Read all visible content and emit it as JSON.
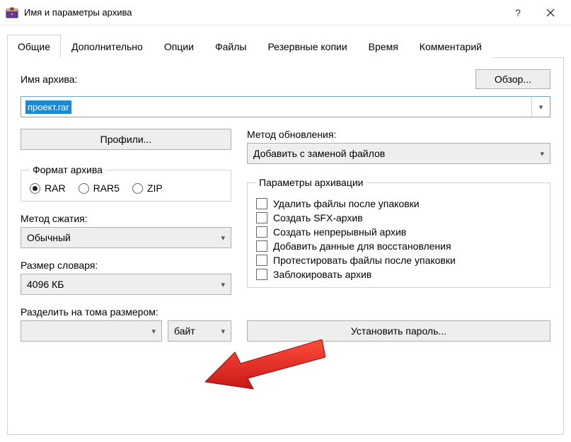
{
  "window": {
    "title": "Имя и параметры архива"
  },
  "tabs": {
    "general": "Общие",
    "advanced": "Дополнительно",
    "options": "Опции",
    "files": "Файлы",
    "backups": "Резервные копии",
    "time": "Время",
    "comment": "Комментарий"
  },
  "archive_name": {
    "label": "Имя архива:",
    "browse": "Обзор...",
    "value": "проект.rar"
  },
  "profiles_button": "Профили...",
  "update": {
    "label": "Метод обновления:",
    "value": "Добавить с заменой файлов"
  },
  "format": {
    "legend": "Формат архива",
    "rar": "RAR",
    "rar5": "RAR5",
    "zip": "ZIP"
  },
  "compression": {
    "label": "Метод сжатия:",
    "value": "Обычный"
  },
  "dictionary": {
    "label": "Размер словаря:",
    "value": "4096 КБ"
  },
  "split": {
    "label": "Разделить на тома размером:",
    "value": "",
    "unit": "байт"
  },
  "params": {
    "legend": "Параметры архивации",
    "delete": "Удалить файлы после упаковки",
    "sfx": "Создать SFX-архив",
    "solid": "Создать непрерывный архив",
    "recovery": "Добавить данные для восстановления",
    "test": "Протестировать файлы после упаковки",
    "lock": "Заблокировать архив"
  },
  "password_button": "Установить пароль..."
}
